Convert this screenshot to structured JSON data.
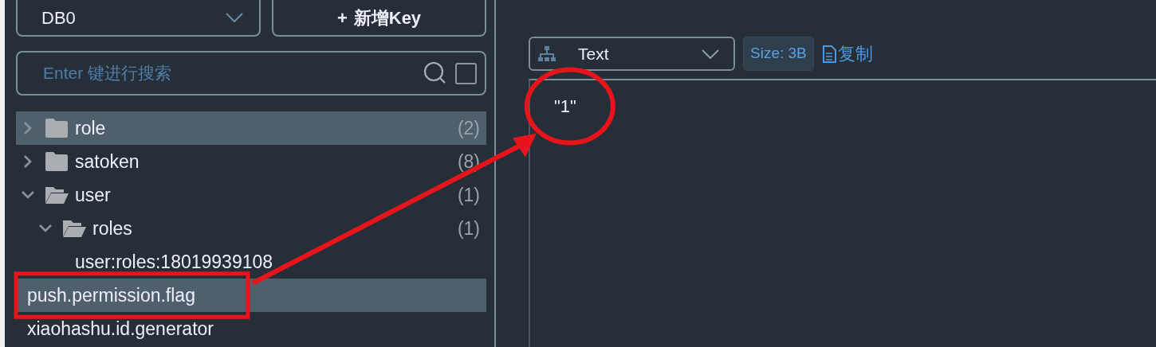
{
  "sidebar": {
    "database": {
      "value": "DB0"
    },
    "add_button": {
      "icon": "+",
      "label": "新增Key"
    },
    "search": {
      "placeholder": "Enter 键进行搜索",
      "exact_match": false
    },
    "tree": [
      {
        "label": "role",
        "count": "(2)",
        "expanded": false,
        "selected": true
      },
      {
        "label": "satoken",
        "count": "(8)",
        "expanded": false,
        "selected": false
      },
      {
        "label": "user",
        "count": "(1)",
        "expanded": true,
        "selected": false,
        "children": [
          {
            "label": "roles",
            "count": "(1)",
            "expanded": true,
            "selected": false,
            "children": [
              {
                "label": "user:roles:18019939108",
                "selected": false
              }
            ]
          }
        ]
      },
      {
        "label": "push.permission.flag",
        "selected": true
      },
      {
        "label": "xiaohashu.id.generator",
        "selected": false
      }
    ]
  },
  "value_panel": {
    "format": "Text",
    "size": "Size: 3B",
    "copy_label": "复制",
    "content": "\"1\""
  },
  "annotations": [
    {
      "kind": "box"
    },
    {
      "kind": "circle"
    },
    {
      "kind": "arrow"
    }
  ]
}
